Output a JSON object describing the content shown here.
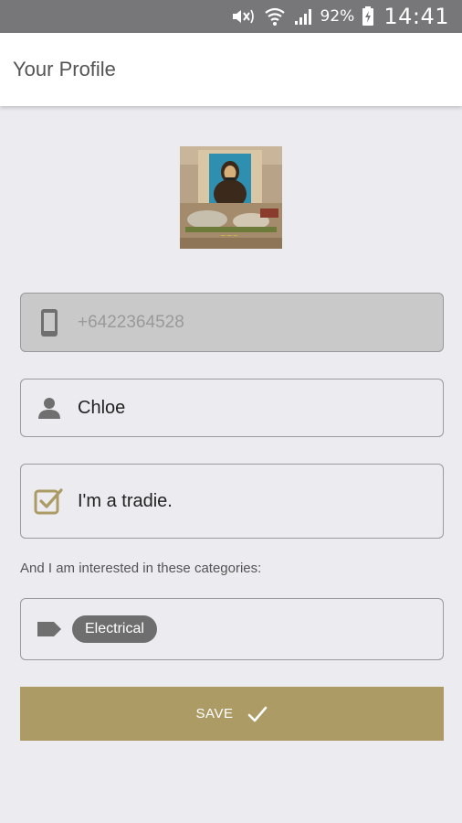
{
  "status_bar": {
    "battery_percent": "92%",
    "time": "14:41"
  },
  "app_bar": {
    "title": "Your Profile"
  },
  "profile": {
    "phone_value": "+6422364528",
    "name_value": "Chloe",
    "tradie_checked": true,
    "tradie_label": "I'm a tradie."
  },
  "categories": {
    "label": "And I am interested in these categories:",
    "selected": [
      "Electrical"
    ]
  },
  "save_button": {
    "label": "SAVE"
  },
  "colors": {
    "accent": "#ad9b66",
    "status_bar": "#777779",
    "background": "#ebebf0",
    "chip": "#6e6e6e"
  }
}
